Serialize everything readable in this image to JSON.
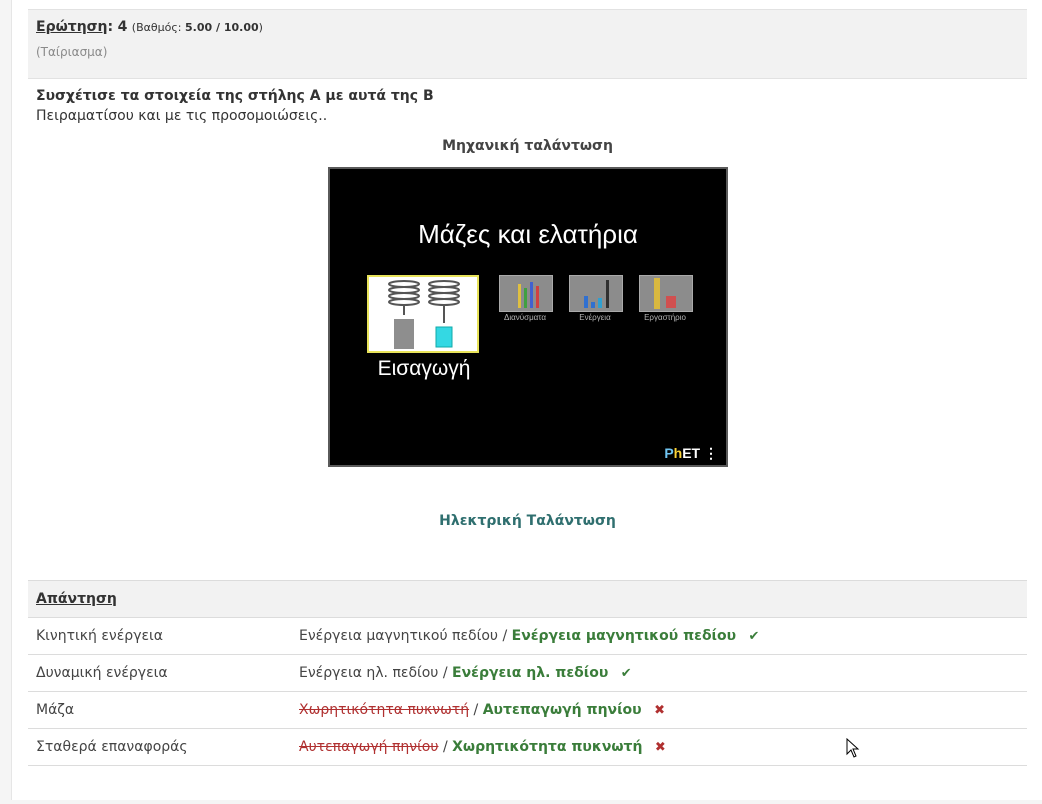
{
  "question": {
    "label": "Ερώτηση",
    "colon": ":",
    "number": "4",
    "grade_open": "(Βαθμός:",
    "grade_value": "5.00 / 10.00",
    "grade_close": ")",
    "type": "(Ταίριασμα)"
  },
  "instructions": {
    "line1": "Συσχέτισε τα στοιχεία της στήλης Α με αυτά της Β",
    "line2": "Πειραματίσου και με τις προσομοιώσεις.."
  },
  "sim1": {
    "heading": "Μηχανική ταλάντωση",
    "title": "Μάζες και ελατήρια",
    "intro_label": "Εισαγωγή",
    "screens": [
      "Διανύσματα",
      "Ενέργεια",
      "Εργαστήριο"
    ],
    "logo": {
      "p": "P",
      "h": "h",
      "e": "ET",
      "menu": "⋮"
    }
  },
  "sim2": {
    "heading": "Ηλεκτρική Ταλάντωση"
  },
  "answer": {
    "heading": "Απάντηση",
    "separator": "/",
    "rows": [
      {
        "left": "Κινητική ενέργεια",
        "given": "Ενέργεια μαγνητικού πεδίου",
        "correct": "Ενέργεια μαγνητικού πεδίου",
        "mark": "✔"
      },
      {
        "left": "Δυναμική ενέργεια",
        "given": "Ενέργεια ηλ. πεδίου",
        "correct": "Ενέργεια ηλ. πεδίου",
        "mark": "✔"
      },
      {
        "left": "Μάζα",
        "given": "Χωρητικότητα πυκνωτή",
        "correct": "Αυτεπαγωγή πηνίου",
        "mark": "✖"
      },
      {
        "left": "Σταθερά επαναφοράς",
        "given": "Αυτεπαγωγή πηνίου",
        "correct": "Χωρητικότητα πυκνωτή",
        "mark": "✖"
      }
    ]
  }
}
